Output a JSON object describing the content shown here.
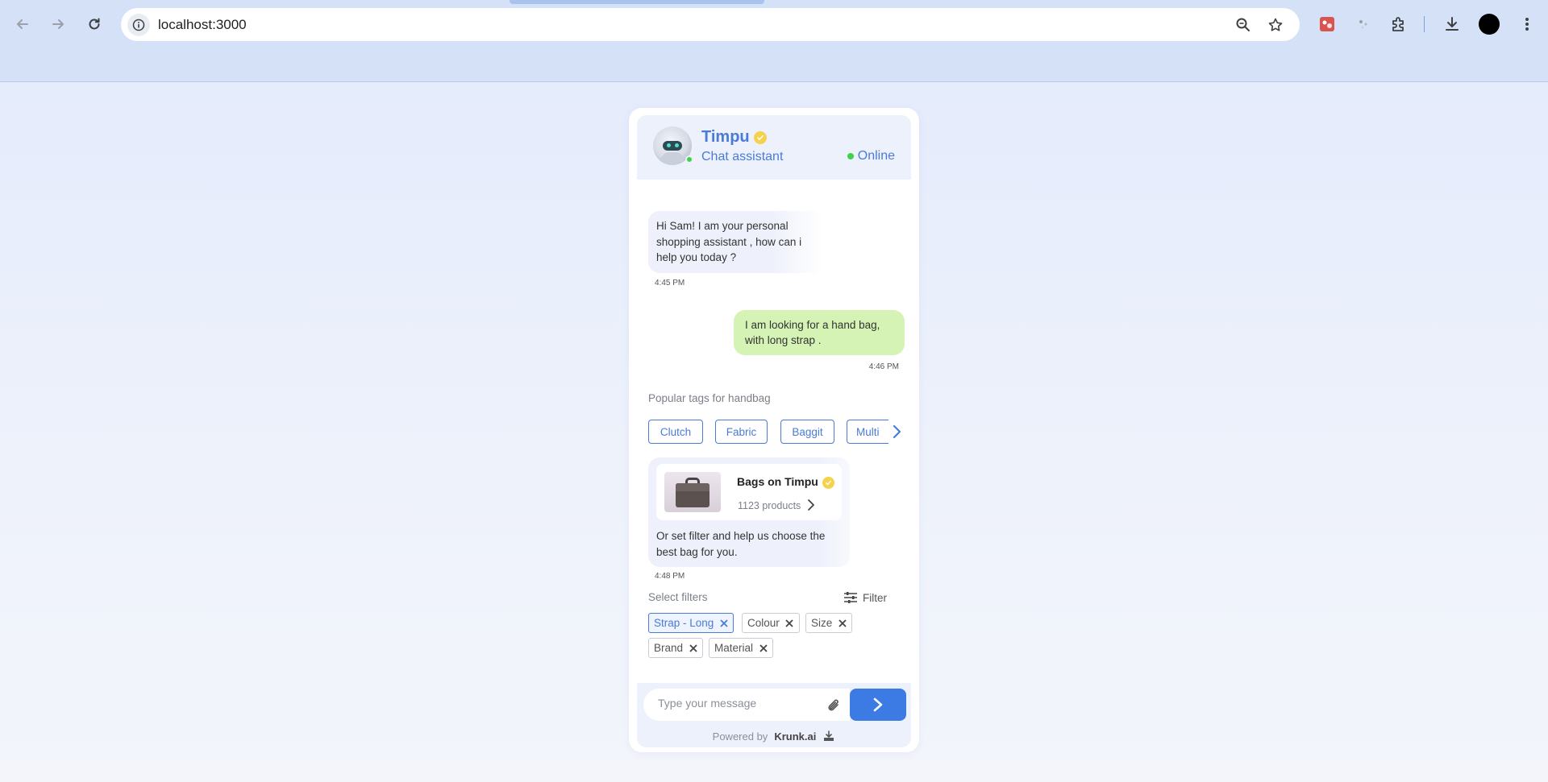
{
  "browser": {
    "url": "localhost:3000"
  },
  "chat": {
    "bot_name": "Timpu",
    "bot_subtitle": "Chat assistant",
    "status": "Online",
    "messages": [
      {
        "from": "bot",
        "text": "Hi Sam! I am your personal shopping assistant , how can i help you today ?",
        "time": "4:45 PM"
      },
      {
        "from": "user",
        "text": "I am looking for a hand bag, with long strap .",
        "time": "4:46 PM"
      }
    ],
    "popular_tags_title": "Popular tags for handbag",
    "tags": [
      "Clutch",
      "Fabric",
      "Baggit",
      "Multi"
    ],
    "product_card": {
      "title": "Bags on Timpu",
      "count": "1123 products",
      "text": "Or set filter and help us choose the best bag for you.",
      "time": "4:48 PM"
    },
    "filters_title": "Select filters",
    "filter_button": "Filter",
    "filter_chips": [
      {
        "label": "Strap - Long",
        "active": true
      },
      {
        "label": "Colour",
        "active": false
      },
      {
        "label": "Size",
        "active": false
      },
      {
        "label": "Brand",
        "active": false
      },
      {
        "label": "Material",
        "active": false
      }
    ],
    "input_placeholder": "Type your message",
    "powered_by": "Powered by",
    "powered_brand": "Krunk.ai"
  },
  "colors": {
    "accent": "#4a7bd6",
    "send_button": "#3d7be4",
    "user_bubble": "#d4f3b4",
    "online": "#3fd34a"
  }
}
